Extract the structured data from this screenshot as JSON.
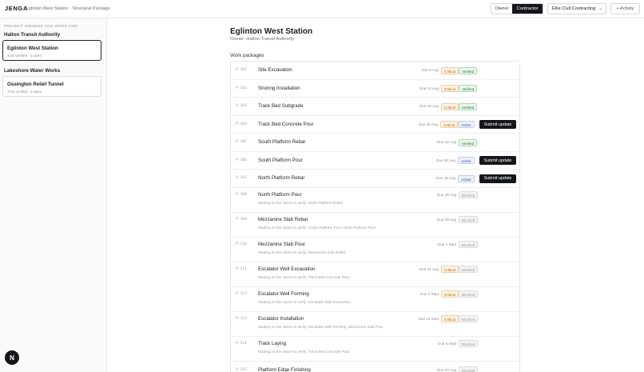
{
  "header": {
    "brand": "JENGA",
    "breadcrumb": "Eglinton West Station · Structural Package",
    "role_owner": "Owner",
    "role_contractor": "Contractor",
    "company": "Ellis Civil Contracting",
    "activity": "+ Activity"
  },
  "sidebar": {
    "caption": "PROJECT OWNERS YOU WORK FOR",
    "orgs": [
      {
        "name": "Halton Transit Authority",
        "projects": [
          {
            "name": "Eglinton West Station",
            "meta": "4/16 verified · 3 open",
            "selected": true
          }
        ]
      },
      {
        "name": "Lakeshore Water Works",
        "projects": [
          {
            "name": "Ossington Relief Tunnel",
            "meta": "7/15 verified · 2 open",
            "selected": false
          }
        ]
      }
    ],
    "fab": "N"
  },
  "main": {
    "title": "Eglinton West Station",
    "owner_line": "Owner: Halton Transit Authority",
    "section_label": "Work packages",
    "submit_label": "Submit update",
    "packages": [
      {
        "code": "P-101",
        "name": "Site Excavation",
        "due": "Due 8 Aug",
        "critical": "Critical",
        "status": "Verified"
      },
      {
        "code": "P-102",
        "name": "Shoring Installation",
        "due": "Due 12 Aug",
        "critical": "Critical",
        "status": "Verified"
      },
      {
        "code": "P-103",
        "name": "Track Bed Subgrade",
        "due": "Due 15 Aug",
        "critical": "Critical",
        "status": "Verified"
      },
      {
        "code": "P-104",
        "name": "Track Bed Concrete Pour",
        "due": "Due 20 Aug",
        "critical": "Critical",
        "status": "Active",
        "submit": true
      },
      {
        "code": "P-105",
        "name": "South Platform Rebar",
        "due": "Due 18 Aug",
        "status": "Verified"
      },
      {
        "code": "P-106",
        "name": "South Platform Pour",
        "due": "Due 25 Aug",
        "status": "Active",
        "submit": true
      },
      {
        "code": "P-107",
        "name": "North Platform Rebar",
        "due": "Due 19 Aug",
        "status": "Active",
        "submit": true
      },
      {
        "code": "P-108",
        "name": "North Platform Pour",
        "due": "Due 25 Aug",
        "status": "Blocked",
        "waiting": "Waiting on the owner to verify: North Platform Rebar"
      },
      {
        "code": "P-109",
        "name": "Mezzanine Slab Rebar",
        "due": "Due 29 Aug",
        "status": "Blocked",
        "waiting": "Waiting on the owner to verify: South Platform Pour, North Platform Pour"
      },
      {
        "code": "P-110",
        "name": "Mezzanine Slab Pour",
        "due": "Due 4 Sept",
        "status": "Blocked",
        "waiting": "Waiting on the owner to verify: Mezzanine Slab Rebar"
      },
      {
        "code": "P-111",
        "name": "Escalator Well Excavation",
        "due": "Due 31 Aug",
        "critical": "Critical",
        "status": "Blocked",
        "waiting": "Waiting on the owner to verify: Track Bed Concrete Pour"
      },
      {
        "code": "P-112",
        "name": "Escalator Well Forming",
        "due": "Due 4 Sept",
        "critical": "Critical",
        "status": "Blocked",
        "waiting": "Waiting on the owner to verify: Escalator Well Excavation"
      },
      {
        "code": "P-113",
        "name": "Escalator Installation",
        "due": "Due 10 Sept",
        "critical": "Critical",
        "status": "Blocked",
        "waiting": "Waiting on the owner to verify: Escalator Well Forming, Mezzanine Slab Pour"
      },
      {
        "code": "P-114",
        "name": "Track Laying",
        "due": "Due 6 Sept",
        "status": "Blocked",
        "waiting": "Waiting on the owner to verify: Track Bed Concrete Pour"
      },
      {
        "code": "P-115",
        "name": "Platform Edge Finishing",
        "due": "Due 20 Aug",
        "status": "Blocked"
      }
    ]
  }
}
